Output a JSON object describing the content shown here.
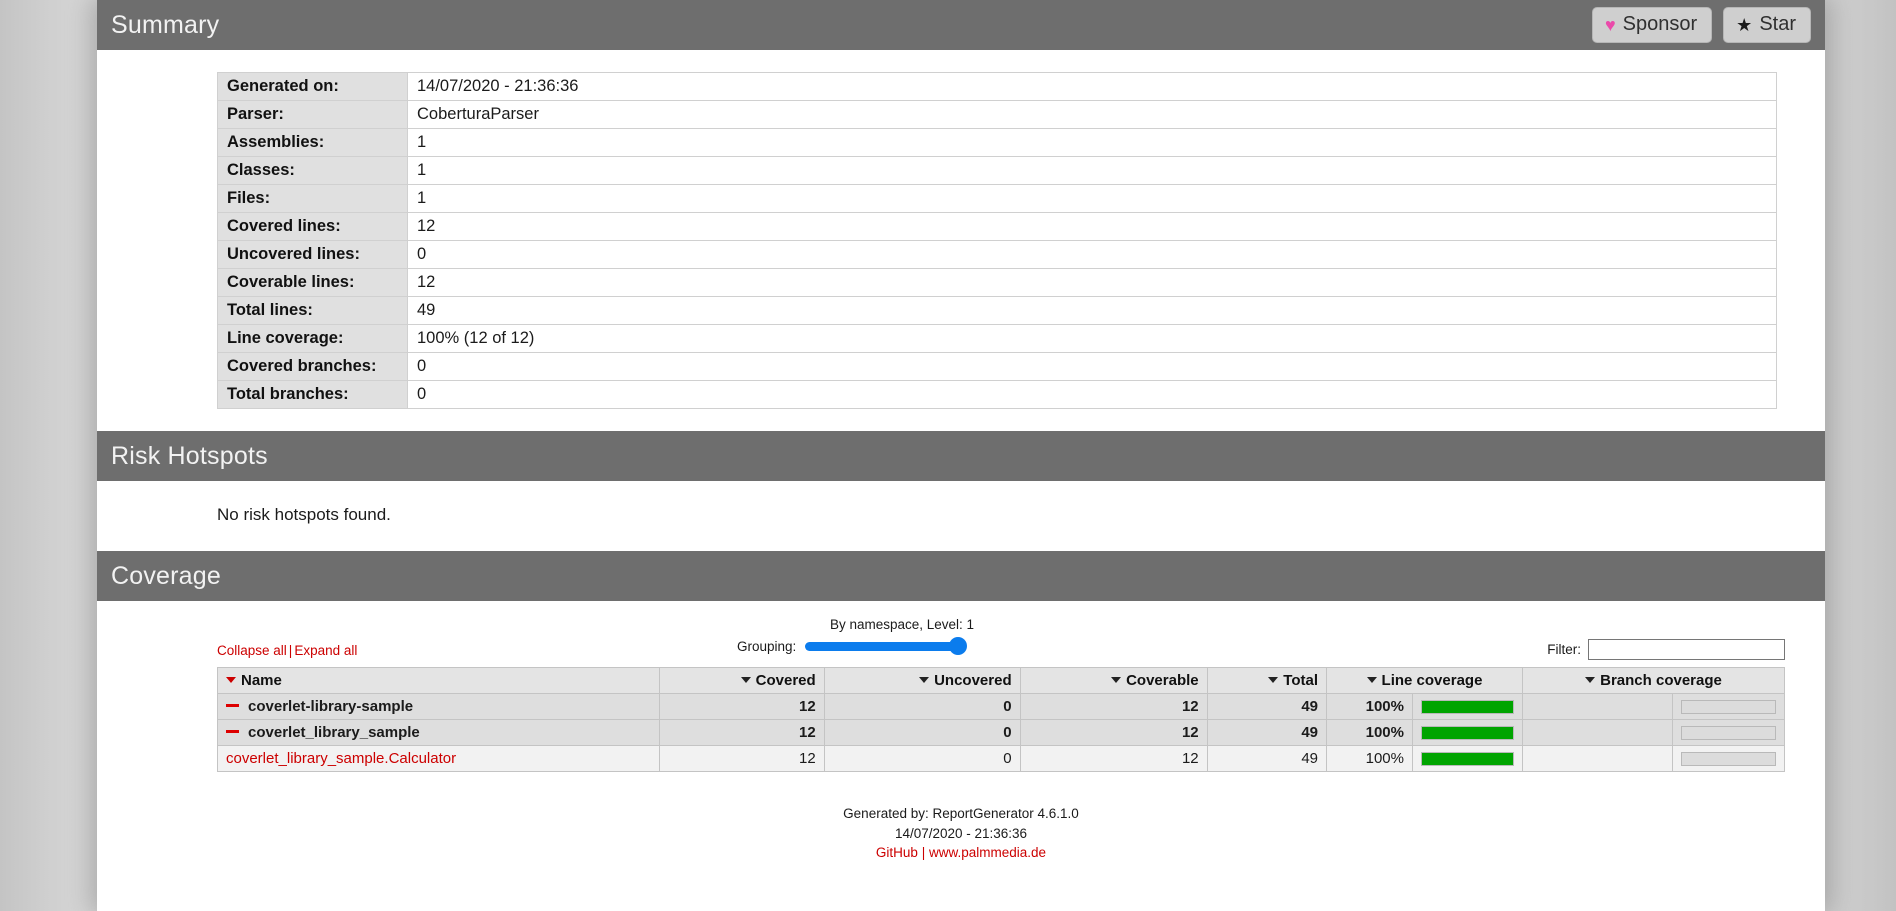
{
  "summary": {
    "title": "Summary",
    "buttons": {
      "sponsor": {
        "label": "Sponsor",
        "icon": "heart-icon",
        "glyph": "♥",
        "color": "#ea4aaa"
      },
      "star": {
        "label": "Star",
        "icon": "star-icon",
        "glyph": "★",
        "color": "#1b1b1b"
      }
    },
    "rows": [
      {
        "label": "Generated on:",
        "value": "14/07/2020 - 21:36:36"
      },
      {
        "label": "Parser:",
        "value": "CoberturaParser"
      },
      {
        "label": "Assemblies:",
        "value": "1"
      },
      {
        "label": "Classes:",
        "value": "1"
      },
      {
        "label": "Files:",
        "value": "1"
      },
      {
        "label": "Covered lines:",
        "value": "12"
      },
      {
        "label": "Uncovered lines:",
        "value": "0"
      },
      {
        "label": "Coverable lines:",
        "value": "12"
      },
      {
        "label": "Total lines:",
        "value": "49"
      },
      {
        "label": "Line coverage:",
        "value": "100% (12 of 12)"
      },
      {
        "label": "Covered branches:",
        "value": "0"
      },
      {
        "label": "Total branches:",
        "value": "0"
      }
    ]
  },
  "risk_hotspots": {
    "title": "Risk Hotspots",
    "empty_message": "No risk hotspots found."
  },
  "coverage": {
    "title": "Coverage",
    "collapse_all": "Collapse all",
    "separator": "|",
    "expand_all": "Expand all",
    "grouping_caption": "By namespace, Level: 1",
    "grouping_label": "Grouping:",
    "grouping_value": 1,
    "grouping_max": 1,
    "filter_label": "Filter:",
    "filter_value": "",
    "filter_placeholder": "",
    "columns": [
      {
        "key": "name",
        "label": "Name",
        "align": "left",
        "sorted": true
      },
      {
        "key": "covered",
        "label": "Covered",
        "align": "right",
        "sorted": false
      },
      {
        "key": "uncovered",
        "label": "Uncovered",
        "align": "right",
        "sorted": false
      },
      {
        "key": "coverable",
        "label": "Coverable",
        "align": "right",
        "sorted": false
      },
      {
        "key": "total",
        "label": "Total",
        "align": "right",
        "sorted": false
      },
      {
        "key": "line_cov",
        "label": "Line coverage",
        "align": "center",
        "sorted": false
      },
      {
        "key": "branch_cov",
        "label": "Branch coverage",
        "align": "center",
        "sorted": false
      }
    ],
    "rows": [
      {
        "name": "coverlet-library-sample",
        "level": 1,
        "toggle": "collapse-icon",
        "is_link": false,
        "covered": "12",
        "uncovered": "0",
        "coverable": "12",
        "total": "49",
        "line_coverage_pct": "100%",
        "line_coverage_value": 100,
        "branch_coverage_pct": "",
        "branch_coverage_value": 0
      },
      {
        "name": "coverlet_library_sample",
        "level": 2,
        "toggle": "collapse-icon",
        "is_link": false,
        "covered": "12",
        "uncovered": "0",
        "coverable": "12",
        "total": "49",
        "line_coverage_pct": "100%",
        "line_coverage_value": 100,
        "branch_coverage_pct": "",
        "branch_coverage_value": 0
      },
      {
        "name": "coverlet_library_sample.Calculator",
        "level": 3,
        "toggle": "",
        "is_link": true,
        "covered": "12",
        "uncovered": "0",
        "coverable": "12",
        "total": "49",
        "line_coverage_pct": "100%",
        "line_coverage_value": 100,
        "branch_coverage_pct": "",
        "branch_coverage_value": 0
      }
    ]
  },
  "footer": {
    "generated_by": "Generated by: ReportGenerator 4.6.1.0",
    "timestamp": "14/07/2020 - 21:36:36",
    "github_link": "GitHub",
    "separator": "|",
    "site_link": "www.palmmedia.de"
  },
  "colors": {
    "section_bar": "#6e6e6e",
    "coverage_green": "#00a400",
    "link_red": "#cc0000",
    "slider_blue": "#0b7ced",
    "heart_pink": "#ea4aaa"
  }
}
